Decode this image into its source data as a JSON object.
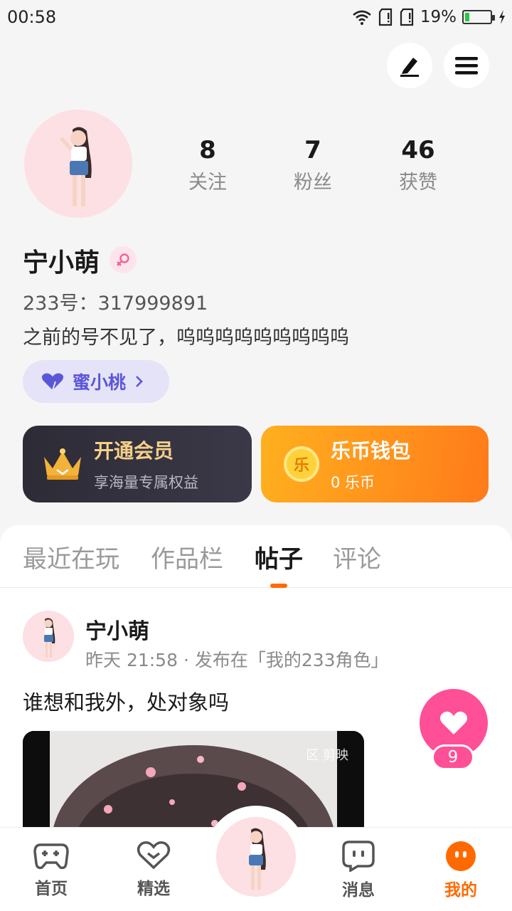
{
  "status_bar": {
    "time": "00:58",
    "battery": "19%",
    "battery_level": 0.19
  },
  "header": {
    "edit_icon": "edit-icon",
    "menu_icon": "menu-icon"
  },
  "profile": {
    "nickname": "宁小萌",
    "gender_icon": "female-icon",
    "uid": "233号：317999891",
    "bio": "之前的号不见了，呜呜呜呜呜呜呜呜呜",
    "tag": "蜜小桃",
    "stats": [
      {
        "num": "8",
        "label": "关注"
      },
      {
        "num": "7",
        "label": "粉丝"
      },
      {
        "num": "46",
        "label": "获赞"
      }
    ]
  },
  "cards": {
    "vip": {
      "title": "开通会员",
      "sub": "享海量专属权益"
    },
    "wallet": {
      "title": "乐币钱包",
      "sub": "0 乐币",
      "coin_glyph": "乐"
    }
  },
  "tabs": [
    {
      "label": "最近在玩",
      "active": false
    },
    {
      "label": "作品栏",
      "active": false
    },
    {
      "label": "帖子",
      "active": true
    },
    {
      "label": "评论",
      "active": false
    }
  ],
  "post": {
    "author": "宁小萌",
    "meta": "昨天 21:58 · 发布在「我的233角色」",
    "text": "谁想和我外，处对象吗",
    "media_watermark": "区 剪映",
    "like_count": "9"
  },
  "bottom_nav": [
    {
      "label": "首页",
      "icon": "gamepad-icon",
      "active": false
    },
    {
      "label": "精选",
      "icon": "heart-badge-icon",
      "active": false
    },
    {
      "label": "",
      "icon": "avatar",
      "active": false
    },
    {
      "label": "消息",
      "icon": "chat-icon",
      "active": false
    },
    {
      "label": "我的",
      "icon": "face-icon",
      "active": true
    }
  ],
  "colors": {
    "accent": "#ff6a00",
    "like": "#ff4f96",
    "tag": "#5b56d8",
    "wallet": "#ff8a1a"
  }
}
